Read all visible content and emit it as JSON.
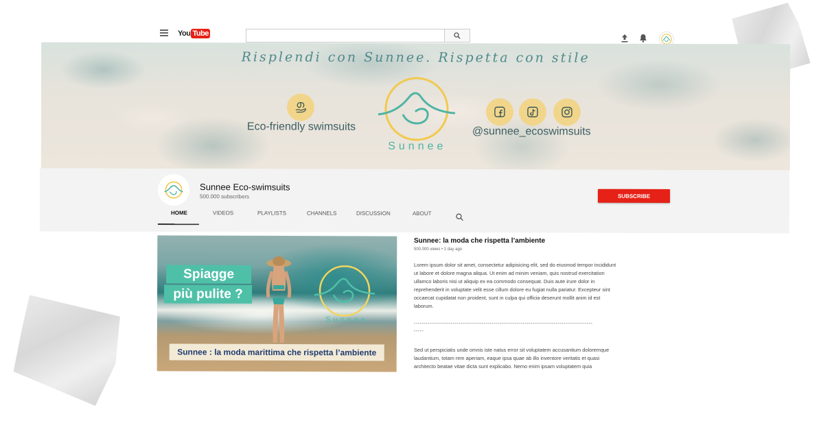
{
  "topbar": {
    "logo_you": "You",
    "logo_tube": "Tube",
    "search_placeholder": ""
  },
  "banner": {
    "slogan": "Risplendi con Sunnee. Rispetta con stile",
    "eco_text": "Eco-friendly swimsuits",
    "handle": "@sunnee_ecoswimsuits",
    "logo_word": "Sunnee"
  },
  "channel": {
    "name": "Sunnee Eco-swimsuits",
    "subscribers": "500.000 subscribers",
    "subscribe_label": "SUBSCRIBE",
    "tabs": [
      {
        "label": "HOME",
        "active": true
      },
      {
        "label": "VIDEOS",
        "active": false
      },
      {
        "label": "PLAYLISTS",
        "active": false
      },
      {
        "label": "CHANNELS",
        "active": false
      },
      {
        "label": "DISCUSSION",
        "active": false
      },
      {
        "label": "ABOUT",
        "active": false
      }
    ]
  },
  "featured_video": {
    "thumb_tag_line1": "Spiagge",
    "thumb_tag_line2": "più pulite ?",
    "thumb_logo_word": "Sunnee",
    "thumb_caption": "Sunnee : la moda marittima che rispetta l’ambiente",
    "title": "Sunnee: la moda che rispetta l’ambiente",
    "meta": "500.000 views • 1 day ago",
    "description": "Lorem ipsum dolor sit amet, consectetur adipisicing elit, sed do eiusmod tempor incididunt ut labore et dolore magna aliqua. Ut enim ad minim veniam, quis nostrud exercitation ullamco laboris nisi ut aliquip ex ea commodo consequat. Duis aute irure dolor in reprehenderit in voluptate velit esse cillum dolore eu fugiat nulla pariatur. Excepteur sint occaecat cupidatat non proident, sunt in culpa qui officia deserunt mollit anim id est laborum.",
    "divider": "--------------------------------------------------------------------------------------------",
    "divider_tail": "-----",
    "description2": "Sed ut perspiciatis unde omnis iste natus error sit voluptatem accusantium doloremque laudantium, totam rem aperiam, eaque ipsa quae ab illo inventore veritatis et quasi architecto beatae vitae dicta sunt explicabo. Nemo enim ipsam voluptatem quia"
  },
  "colors": {
    "subscribe_red": "#e62117",
    "brand_teal": "#4fb4a4",
    "brand_yellow": "#f1d58a"
  },
  "icons": [
    "menu-icon",
    "search-icon",
    "upload-icon",
    "bell-icon",
    "leaf-hand-icon",
    "facebook-icon",
    "tiktok-icon",
    "instagram-icon"
  ]
}
